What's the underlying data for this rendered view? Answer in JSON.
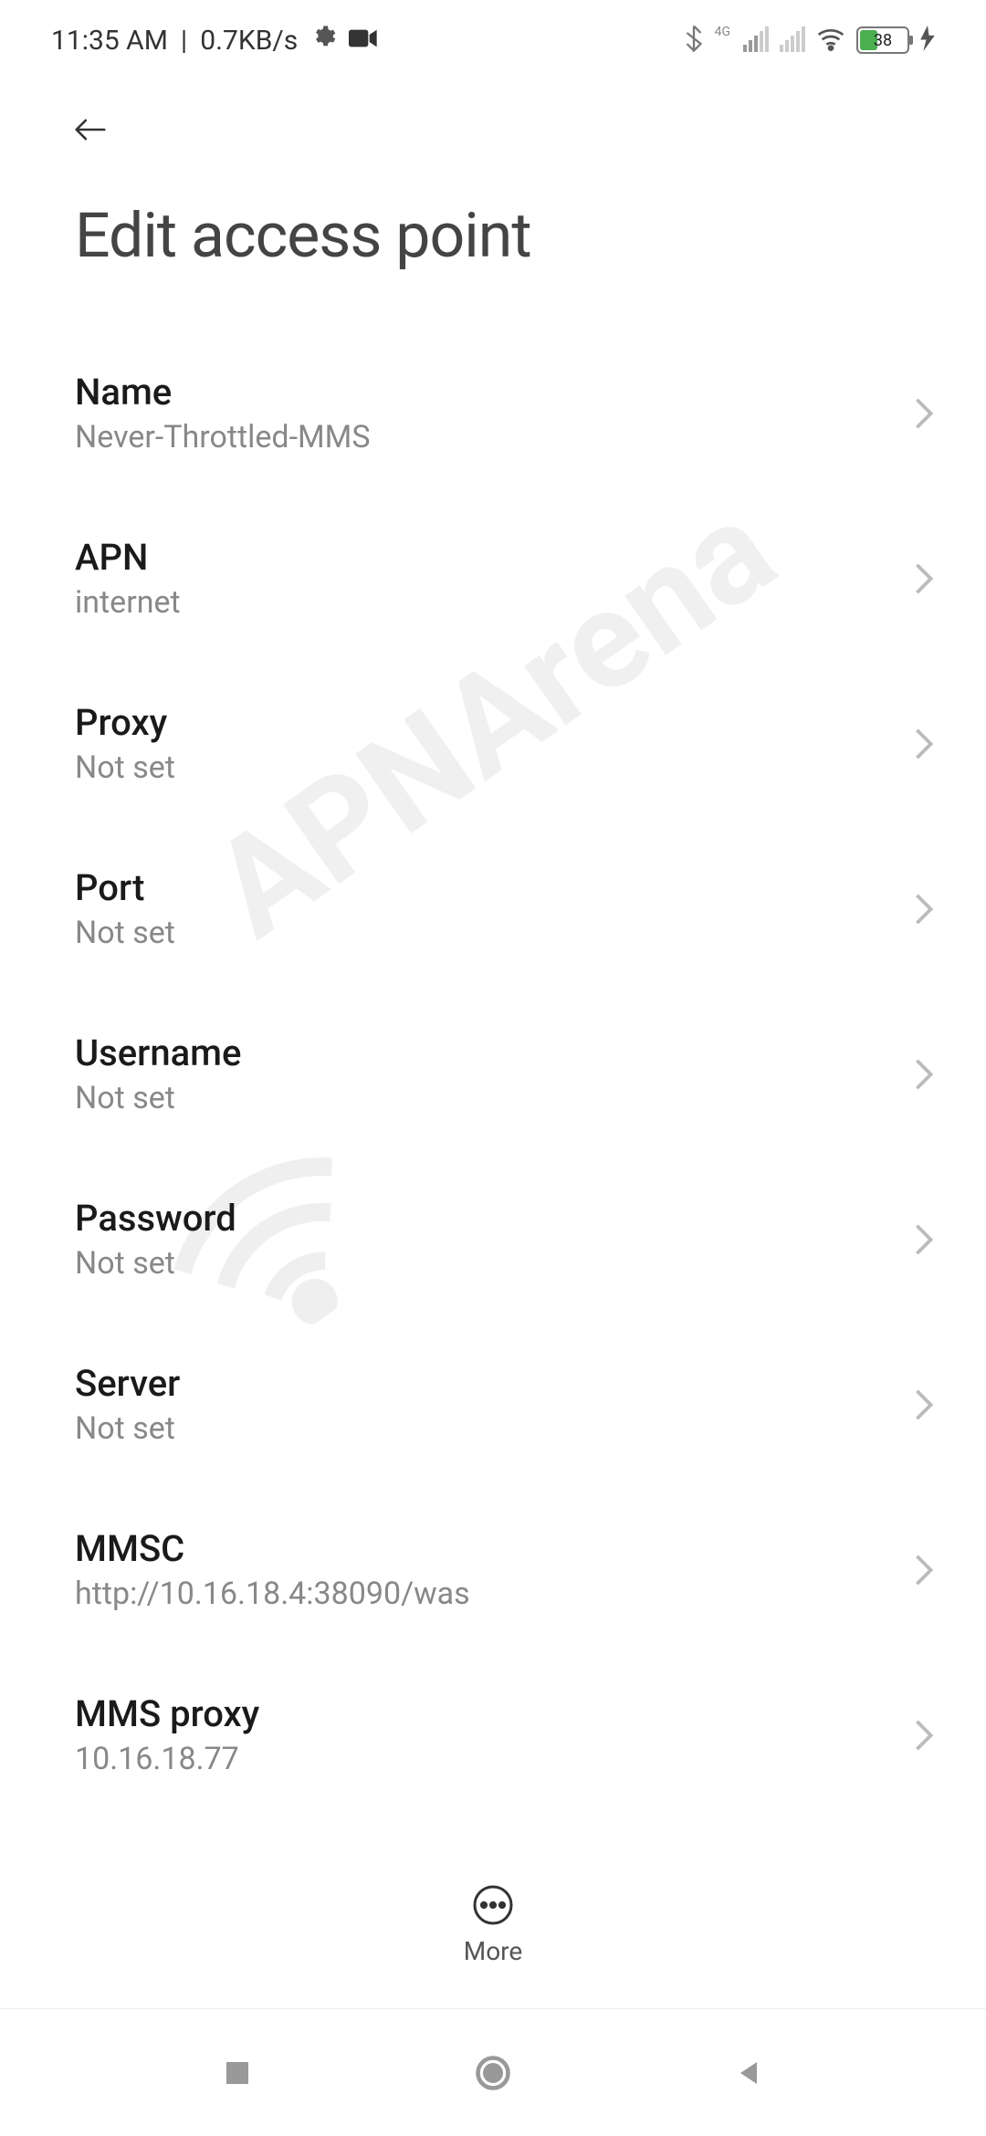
{
  "status_bar": {
    "time": "11:35 AM",
    "data_rate": "0.7KB/s",
    "network_label_4g": "4G",
    "battery_percent": "38"
  },
  "header": {
    "title": "Edit access point"
  },
  "settings": [
    {
      "label": "Name",
      "value": "Never-Throttled-MMS"
    },
    {
      "label": "APN",
      "value": "internet"
    },
    {
      "label": "Proxy",
      "value": "Not set"
    },
    {
      "label": "Port",
      "value": "Not set"
    },
    {
      "label": "Username",
      "value": "Not set"
    },
    {
      "label": "Password",
      "value": "Not set"
    },
    {
      "label": "Server",
      "value": "Not set"
    },
    {
      "label": "MMSC",
      "value": "http://10.16.18.4:38090/was"
    },
    {
      "label": "MMS proxy",
      "value": "10.16.18.77"
    }
  ],
  "bottom": {
    "more_label": "More"
  },
  "watermark_text": "APNArena"
}
